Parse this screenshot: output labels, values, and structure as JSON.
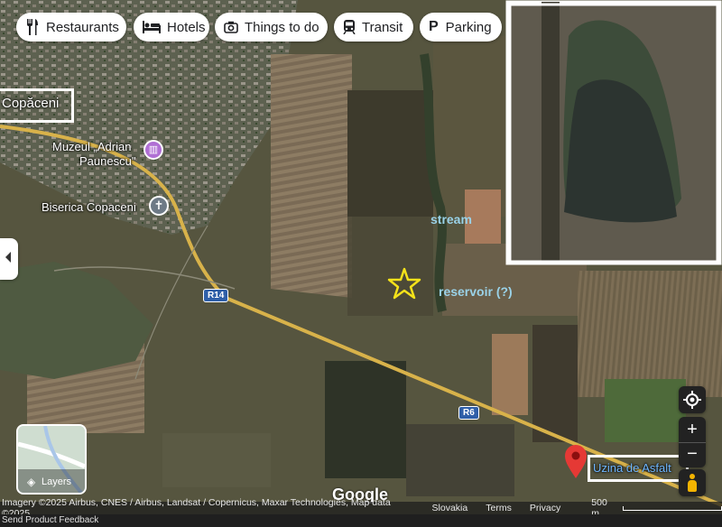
{
  "chips": {
    "restaurants": "Restaurants",
    "hotels": "Hotels",
    "things_to_do": "Things to do",
    "transit": "Transit",
    "parking": "Parking"
  },
  "places": {
    "copaceni": "Copăceni",
    "muzeu_line1": "Muzeul „Adrian",
    "muzeu_line2": "Paunescu\"",
    "biserica": "Biserica Copaceni",
    "uzina": "Uzina de Asfalt"
  },
  "roads": {
    "r14": "R14",
    "r6": "R6"
  },
  "annotations": {
    "stream": "stream",
    "reservoir": "reservoir (?)"
  },
  "layers_label": "Layers",
  "google_logo": "Google",
  "footer": {
    "imagery": "Imagery ©2025 Airbus, CNES / Airbus, Landsat / Copernicus, Maxar Technologies, Map data ©2025",
    "country": "Slovakia",
    "terms": "Terms",
    "privacy": "Privacy",
    "scale": "500 m",
    "send_feedback": "Send Product Feedback"
  },
  "colors": {
    "star": "#f4e21a",
    "annotation": "#9ad2e8",
    "road": "#d8b24a",
    "pin": "#e53935",
    "poi_museum": "#b06fd4"
  },
  "icons": [
    "fork-knife-icon",
    "bed-icon",
    "camera-icon",
    "train-icon",
    "parking-icon",
    "museum-icon",
    "church-icon",
    "star-icon",
    "location-pin-icon",
    "my-location-icon",
    "zoom-in-icon",
    "zoom-out-icon",
    "layers-icon",
    "pegman-icon",
    "collapse-arrow-icon"
  ]
}
